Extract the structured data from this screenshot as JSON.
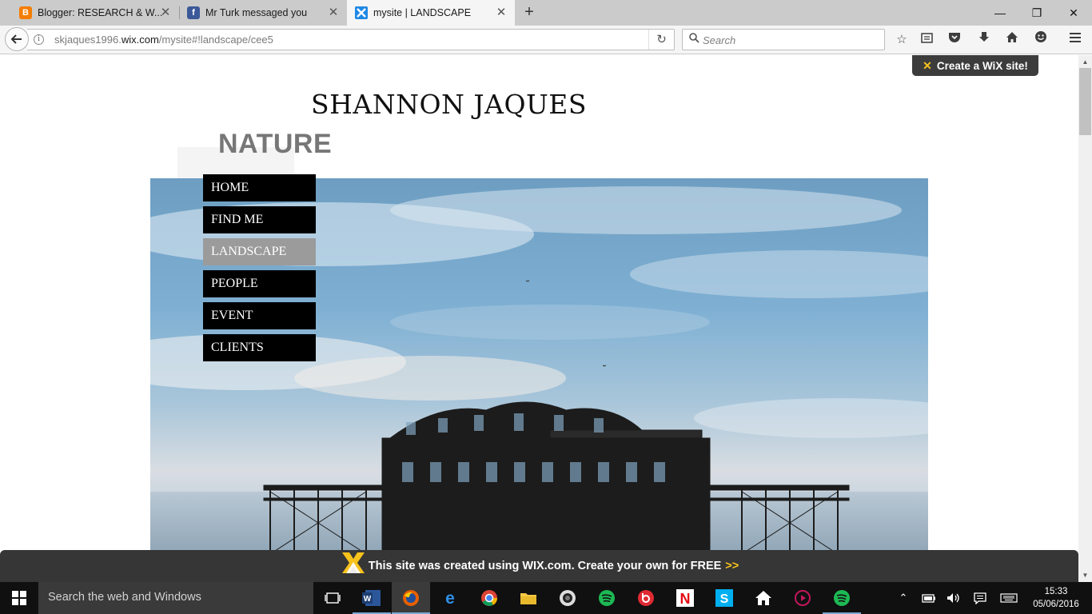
{
  "browser": {
    "tabs": [
      {
        "title": "Blogger: RESEARCH & W...",
        "icon": "blogger-icon",
        "color": "#f57d00",
        "glyph": "B"
      },
      {
        "title": "Mr Turk messaged you",
        "icon": "facebook-icon",
        "color": "#3b5998",
        "glyph": "f"
      },
      {
        "title": "mysite | LANDSCAPE",
        "icon": "wix-icon",
        "color": "#1da1f2",
        "glyph": "X"
      }
    ],
    "active_tab_index": 2,
    "url_prefix": "skjaques1996.",
    "url_domain": "wix.com",
    "url_path": "/mysite#!landscape/cee5",
    "search_placeholder": "Search"
  },
  "site": {
    "title": "SHANNON JAQUES",
    "subtitle": "NATURE",
    "create_wix_label": "Create a WiX site!",
    "menu": [
      {
        "label": "HOME"
      },
      {
        "label": "FIND ME"
      },
      {
        "label": "LANDSCAPE"
      },
      {
        "label": "PEOPLE"
      },
      {
        "label": "EVENT"
      },
      {
        "label": "CLIENTS"
      }
    ],
    "active_menu_index": 2,
    "banner_text": "This site was created using WIX.com. Create your own for FREE",
    "banner_link": ">>"
  },
  "taskbar": {
    "search_placeholder": "Search the web and Windows",
    "time": "15:33",
    "date": "05/06/2016"
  },
  "colors": {
    "wix_yellow": "#f8c21c",
    "menu_active": "#9b9b9b",
    "menu_bg": "#000000"
  }
}
